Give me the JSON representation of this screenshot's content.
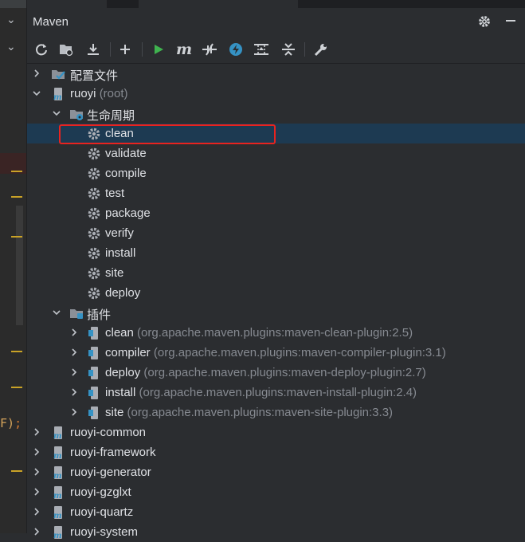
{
  "panel": {
    "title": "Maven"
  },
  "editor": {
    "code_fragment": "F)",
    "code_semicolon": ";"
  },
  "toolbar": {
    "buttons": [
      {
        "name": "reload-icon"
      },
      {
        "name": "add-folder-icon"
      },
      {
        "name": "download-icon"
      },
      {
        "name": "add-icon"
      },
      {
        "name": "run-icon"
      },
      {
        "name": "maven-goal-icon"
      },
      {
        "name": "toggle-offline-icon"
      },
      {
        "name": "skip-tests-icon"
      },
      {
        "name": "show-dependencies-icon"
      },
      {
        "name": "collapse-all-icon"
      },
      {
        "name": "settings-wrench-icon"
      }
    ]
  },
  "tree": {
    "profiles": "配置文件",
    "root_project": {
      "name": "ruoyi",
      "suffix": "(root)"
    },
    "lifecycle": {
      "label": "生命周期",
      "phases": [
        "clean",
        "validate",
        "compile",
        "test",
        "package",
        "verify",
        "install",
        "site",
        "deploy"
      ]
    },
    "plugins": {
      "label": "插件",
      "items": [
        {
          "name": "clean",
          "detail": "(org.apache.maven.plugins:maven-clean-plugin:2.5)"
        },
        {
          "name": "compiler",
          "detail": "(org.apache.maven.plugins:maven-compiler-plugin:3.1)"
        },
        {
          "name": "deploy",
          "detail": "(org.apache.maven.plugins:maven-deploy-plugin:2.7)"
        },
        {
          "name": "install",
          "detail": "(org.apache.maven.plugins:maven-install-plugin:2.4)"
        },
        {
          "name": "site",
          "detail": "(org.apache.maven.plugins:maven-site-plugin:3.3)"
        }
      ]
    },
    "modules": [
      "ruoyi-common",
      "ruoyi-framework",
      "ruoyi-generator",
      "ruoyi-gzglxt",
      "ruoyi-quartz",
      "ruoyi-system"
    ]
  },
  "colors": {
    "selection": "#1d3a52",
    "highlight": "#e8231f",
    "run": "#3fb34f",
    "accent": "#3592c4"
  }
}
